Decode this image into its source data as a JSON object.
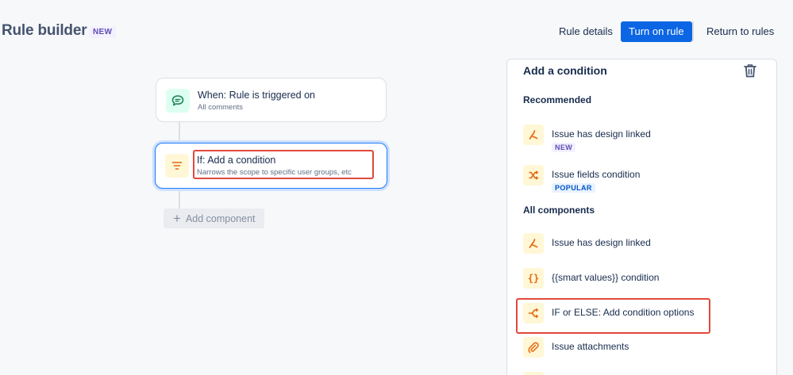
{
  "header": {
    "title": "Rule builder",
    "badge": "NEW",
    "rule_details_label": "Rule details",
    "turn_on_label": "Turn on rule",
    "return_label": "Return to rules"
  },
  "flow": {
    "trigger": {
      "title": "When: Rule is triggered on",
      "subtitle": "All comments",
      "icon": "comment-icon"
    },
    "condition": {
      "title": "If: Add a condition",
      "subtitle": "Narrows the scope to specific user groups, etc",
      "icon": "filter-icon"
    },
    "add_component_label": "Add component"
  },
  "panel": {
    "title": "Add a condition",
    "recommended_heading": "Recommended",
    "recommended": [
      {
        "label": "Issue has design linked",
        "tag": "NEW",
        "icon": "design-link-icon"
      },
      {
        "label": "Issue fields condition",
        "tag": "POPULAR",
        "icon": "shuffle-icon"
      }
    ],
    "all_heading": "All components",
    "all": [
      {
        "label": "Issue has design linked",
        "icon": "design-link-icon"
      },
      {
        "label": "{{smart values}} condition",
        "icon": "curly-braces-icon",
        "glyph": "{}"
      },
      {
        "label": "IF or ELSE: Add condition options",
        "icon": "branch-icon"
      },
      {
        "label": "Issue attachments",
        "icon": "paperclip-icon"
      }
    ]
  },
  "colors": {
    "accent": "#0c66e4",
    "highlight": "#e2483d",
    "icon_orange": "#e56910",
    "icon_teal": "#1f845a"
  }
}
